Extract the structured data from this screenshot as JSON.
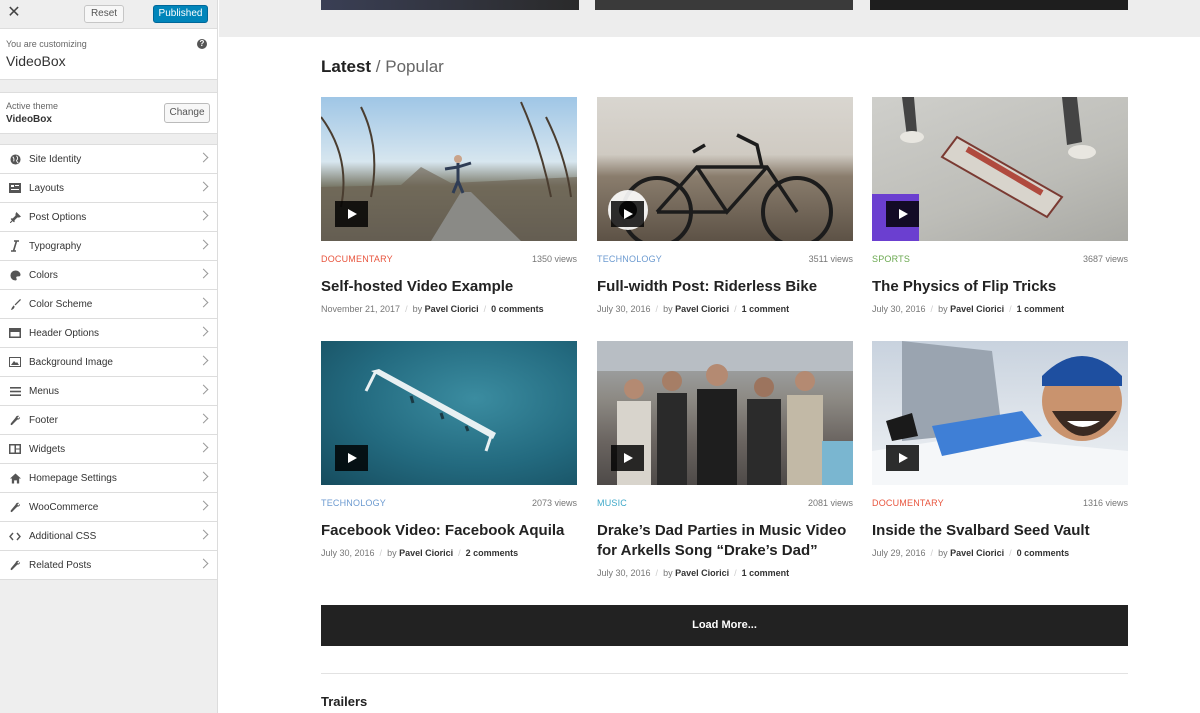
{
  "sidebar": {
    "reset_label": "Reset",
    "published_label": "Published",
    "customizing_label": "You are customizing",
    "site_name": "VideoBox",
    "active_theme_label": "Active theme",
    "theme_name": "VideoBox",
    "change_label": "Change",
    "items": [
      {
        "label": "Site Identity",
        "icon": "globe-icon"
      },
      {
        "label": "Layouts",
        "icon": "layout-icon"
      },
      {
        "label": "Post Options",
        "icon": "pin-icon"
      },
      {
        "label": "Typography",
        "icon": "italic-icon"
      },
      {
        "label": "Colors",
        "icon": "palette-icon"
      },
      {
        "label": "Color Scheme",
        "icon": "brush-icon"
      },
      {
        "label": "Header Options",
        "icon": "header-icon"
      },
      {
        "label": "Background Image",
        "icon": "image-icon"
      },
      {
        "label": "Menus",
        "icon": "menu-icon"
      },
      {
        "label": "Footer",
        "icon": "wrench-icon"
      },
      {
        "label": "Widgets",
        "icon": "widgets-icon"
      },
      {
        "label": "Homepage Settings",
        "icon": "home-icon"
      },
      {
        "label": "WooCommerce",
        "icon": "wrench-icon"
      },
      {
        "label": "Additional CSS",
        "icon": "code-icon"
      },
      {
        "label": "Related Posts",
        "icon": "wrench-icon"
      }
    ]
  },
  "main": {
    "section_strong": "Latest",
    "section_sep": " / ",
    "section_light": "Popular",
    "colors": {
      "documentary": "#e8553e",
      "technology": "#6c9ad0",
      "sports": "#6aa84f",
      "music": "#3ea8c8"
    },
    "posts": [
      {
        "category": "DOCUMENTARY",
        "views": "1350 views",
        "title": "Self-hosted Video Example",
        "date": "November 21, 2017",
        "by": "by",
        "author": "Pavel Ciorici",
        "comments": "0 comments"
      },
      {
        "category": "TECHNOLOGY",
        "views": "3511 views",
        "title": "Full-width Post: Riderless Bike",
        "date": "July 30, 2016",
        "by": "by",
        "author": "Pavel Ciorici",
        "comments": "1 comment"
      },
      {
        "category": "SPORTS",
        "views": "3687 views",
        "title": "The Physics of Flip Tricks",
        "date": "July 30, 2016",
        "by": "by",
        "author": "Pavel Ciorici",
        "comments": "1 comment"
      },
      {
        "category": "TECHNOLOGY",
        "views": "2073 views",
        "title": "Facebook Video: Facebook Aquila",
        "date": "July 30, 2016",
        "by": "by",
        "author": "Pavel Ciorici",
        "comments": "2 comments"
      },
      {
        "category": "MUSIC",
        "views": "2081 views",
        "title": "Drake’s Dad Parties in Music Video for Arkells Song “Drake’s Dad”",
        "date": "July 30, 2016",
        "by": "by",
        "author": "Pavel Ciorici",
        "comments": "1 comment"
      },
      {
        "category": "DOCUMENTARY",
        "views": "1316 views",
        "title": "Inside the Svalbard Seed Vault",
        "date": "July 29, 2016",
        "by": "by",
        "author": "Pavel Ciorici",
        "comments": "0 comments"
      }
    ],
    "load_more_label": "Load More...",
    "trailers_label": "Trailers"
  }
}
